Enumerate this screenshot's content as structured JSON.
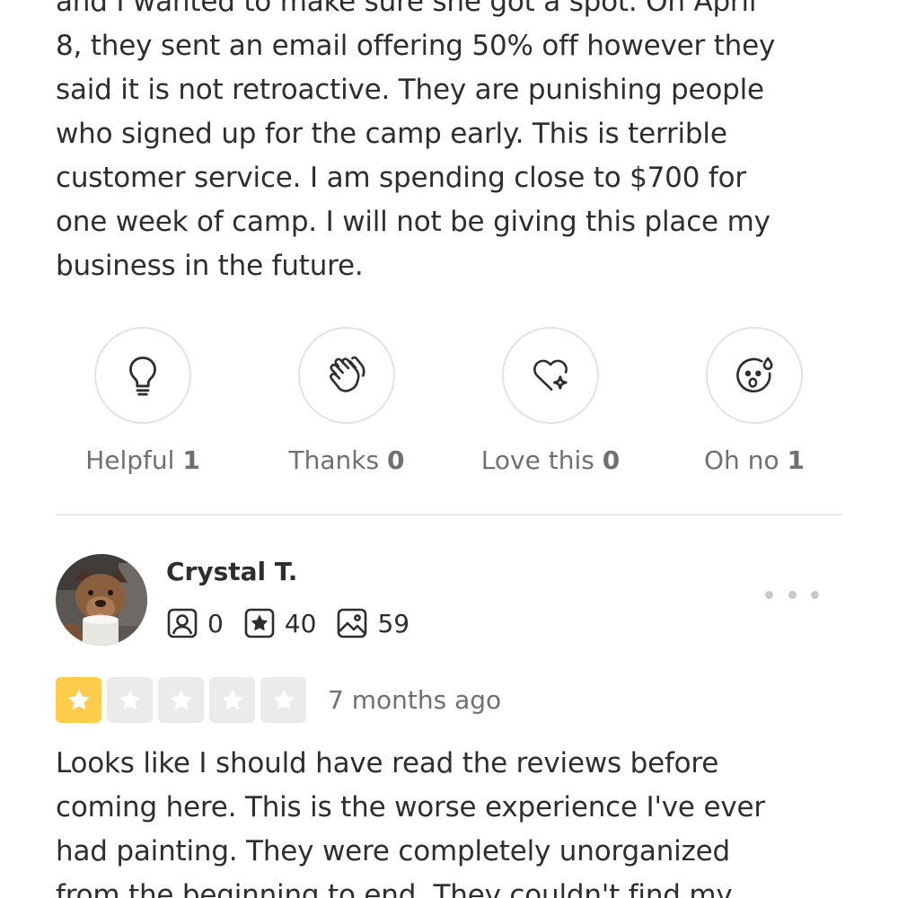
{
  "previous_review": {
    "lines": [
      "and I wanted to make sure she got a spot. On April",
      "8, they sent an email offering 50% off however they",
      "said it is not retroactive. They are punishing people",
      "who signed up for the camp early. This is terrible",
      "customer service. I am spending close to $700 for",
      "one week of camp. I will not be giving this place my",
      "business in the future."
    ],
    "reactions": [
      {
        "label": "Helpful",
        "count": "1",
        "icon": "lightbulb-icon"
      },
      {
        "label": "Thanks",
        "count": "0",
        "icon": "clapping-hands-icon"
      },
      {
        "label": "Love this",
        "count": "0",
        "icon": "heart-sparkle-icon"
      },
      {
        "label": "Oh no",
        "count": "1",
        "icon": "shocked-face-icon"
      }
    ]
  },
  "next_review": {
    "user": {
      "name": "Crystal T.",
      "friends": "0",
      "reviews": "40",
      "photos": "59"
    },
    "rating": 1,
    "rating_max": 5,
    "date": "7 months ago",
    "lines": [
      "Looks like I should have read the reviews before",
      "coming here. This is the worse experience I've ever",
      "had painting. They were completely unorganized",
      "from the beginning to end. They couldn't find my"
    ]
  },
  "colors": {
    "star_filled": "#ffcc4b",
    "star_empty": "#ebebeb",
    "text": "#2d2e2f",
    "muted": "#6e7072"
  }
}
